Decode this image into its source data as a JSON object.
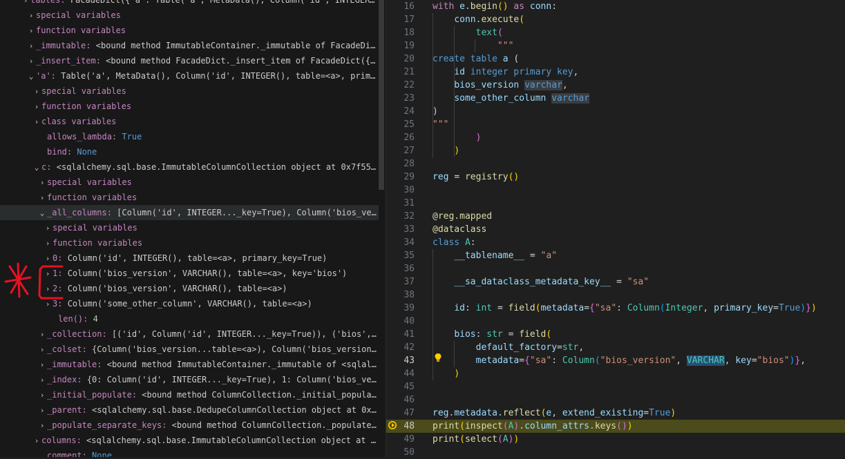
{
  "variables_tree": [
    {
      "chevron": "›",
      "name": "tables:",
      "value": "FacadeDict({'a': Table('a', MetaData(), Column('id', INTEGER…"
    },
    {
      "chevron": "›",
      "name": "special variables",
      "value": ""
    },
    {
      "chevron": "›",
      "name": "function variables",
      "value": ""
    },
    {
      "chevron": "›",
      "name": "_immutable:",
      "value": "<bound method ImmutableContainer._immutable of FacadeDic…"
    },
    {
      "chevron": "›",
      "name": "_insert_item:",
      "value": "<bound method FacadeDict._insert_item of FacadeDict({'…"
    },
    {
      "chevron": "⌄",
      "name": "'a':",
      "value": "Table('a', MetaData(), Column('id', INTEGER(), table=<a>, prima…"
    },
    {
      "chevron": "›",
      "name": "special variables",
      "value": ""
    },
    {
      "chevron": "›",
      "name": "function variables",
      "value": ""
    },
    {
      "chevron": "›",
      "name": "class variables",
      "value": ""
    },
    {
      "chevron": "",
      "name": "allows_lambda:",
      "value": "True"
    },
    {
      "chevron": "",
      "name": "bind:",
      "value": "None"
    },
    {
      "chevron": "⌄",
      "name": "c:",
      "value": "<sqlalchemy.sql.base.ImmutableColumnCollection object at 0x7f555…"
    },
    {
      "chevron": "›",
      "name": "special variables",
      "value": ""
    },
    {
      "chevron": "›",
      "name": "function variables",
      "value": ""
    },
    {
      "chevron": "⌄",
      "name": "_all_columns:",
      "value": "[Column('id', INTEGER..._key=True), Column('bios_ve…"
    },
    {
      "chevron": "›",
      "name": "special variables",
      "value": ""
    },
    {
      "chevron": "›",
      "name": "function variables",
      "value": ""
    },
    {
      "chevron": "›",
      "name": "0:",
      "value": "Column('id', INTEGER(), table=<a>, primary_key=True)"
    },
    {
      "chevron": "›",
      "name": "1:",
      "value": "Column('bios_version', VARCHAR(), table=<a>, key='bios')"
    },
    {
      "chevron": "›",
      "name": "2:",
      "value": "Column('bios_version', VARCHAR(), table=<a>)"
    },
    {
      "chevron": "›",
      "name": "3:",
      "value": "Column('some_other_column', VARCHAR(), table=<a>)"
    },
    {
      "chevron": "",
      "name": "len():",
      "value": "4"
    },
    {
      "chevron": "›",
      "name": "_collection:",
      "value": "[('id', Column('id', INTEGER..._key=True)), ('bios', …"
    },
    {
      "chevron": "›",
      "name": "_colset:",
      "value": "{Column('bios_version...table=<a>), Column('bios_version…"
    },
    {
      "chevron": "›",
      "name": "_immutable:",
      "value": "<bound method ImmutableContainer._immutable of <sqlalc…"
    },
    {
      "chevron": "›",
      "name": "_index:",
      "value": "{0: Column('id', INTEGER..._key=True), 1: Column('bios_ver…"
    },
    {
      "chevron": "›",
      "name": "_initial_populate:",
      "value": "<bound method ColumnCollection._initial_populat…"
    },
    {
      "chevron": "›",
      "name": "_parent:",
      "value": "<sqlalchemy.sql.base.DedupeColumnCollection object at 0x7…"
    },
    {
      "chevron": "›",
      "name": "_populate_separate_keys:",
      "value": "<bound method ColumnCollection._populate_…"
    },
    {
      "chevron": "›",
      "name": "columns:",
      "value": "<sqlalchemy.sql.base.ImmutableColumnCollection object at 0…"
    },
    {
      "chevron": "",
      "name": "comment:",
      "value": "None"
    }
  ],
  "editor": {
    "current_line": "48",
    "hint_line": "43",
    "line_numbers": [
      "16",
      "17",
      "18",
      "19",
      "20",
      "21",
      "22",
      "23",
      "24",
      "25",
      "26",
      "27",
      "28",
      "29",
      "30",
      "31",
      "32",
      "33",
      "34",
      "35",
      "36",
      "37",
      "38",
      "39",
      "40",
      "41",
      "42",
      "43",
      "44",
      "45",
      "46",
      "47",
      "48",
      "49",
      "50"
    ]
  }
}
